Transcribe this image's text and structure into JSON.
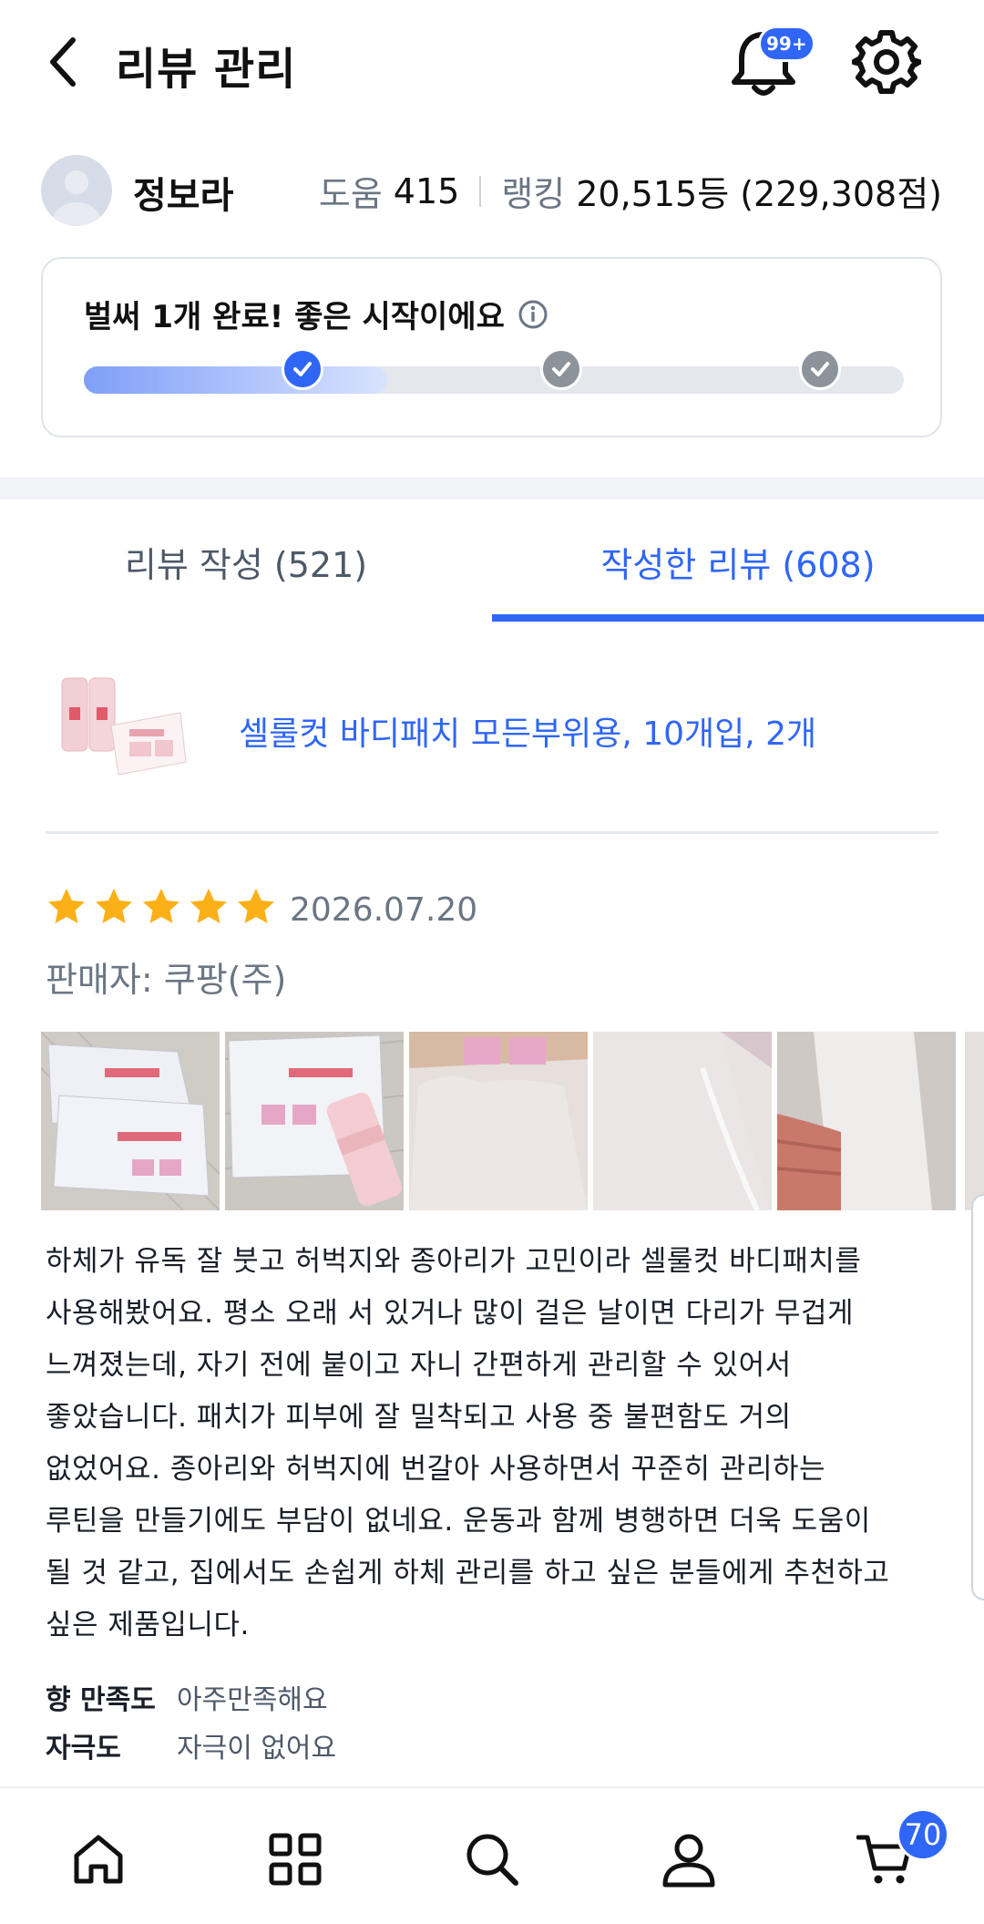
{
  "header": {
    "title": "리뷰 관리",
    "notification_badge": "99+"
  },
  "profile": {
    "name": "정보라",
    "help_label": "도움",
    "help_value": "415",
    "ranking_label": "랭킹",
    "ranking_value": "20,515등 (229,308점)"
  },
  "progress": {
    "message": "벌써 1개 완료! 좋은 시작이에요",
    "completed_steps": 1,
    "total_steps": 3,
    "fill_fraction": 0.37
  },
  "tabs": [
    {
      "label": "리뷰 작성 (521)",
      "active": false
    },
    {
      "label": "작성한 리뷰 (608)",
      "active": true
    }
  ],
  "product": {
    "name": "셀룰컷 바디패치 모든부위용, 10개입, 2개"
  },
  "review": {
    "rating": 5,
    "date": "2026.07.20",
    "seller": "판매자: 쿠팡(주)",
    "photo_count": 5,
    "body_lines": [
      "하체가 유독 잘 붓고 허벅지와 종아리가 고민이라 셀룰컷 바디패치를",
      "사용해봤어요. 평소 오래 서 있거나 많이 걸은 날이면 다리가 무겁게",
      "느껴졌는데, 자기 전에 붙이고 자니 간편하게 관리할 수 있어서",
      "좋았습니다. 패치가 피부에 잘 밀착되고 사용 중 불편함도 거의",
      "없었어요. 종아리와 허벅지에 번갈아 사용하면서 꾸준히 관리하는",
      "루틴을 만들기에도 부담이 없네요. 운동과 함께 병행하면 더욱 도움이",
      "될 것 같고, 집에서도 손쉽게 하체 관리를 하고 싶은 분들에게 추천하고",
      "싶은 제품입니다."
    ],
    "attributes": [
      {
        "key": "향 만족도",
        "value": "아주만족해요"
      },
      {
        "key": "자극도",
        "value": "자극이 없어요"
      }
    ]
  },
  "bottom_nav": {
    "items": [
      "home-icon",
      "categories-icon",
      "search-icon",
      "my-account-icon",
      "cart-icon"
    ],
    "cart_badge": "70"
  },
  "colors": {
    "accent": "#2f66f6",
    "star": "#fbb018",
    "muted": "#6b7684"
  }
}
